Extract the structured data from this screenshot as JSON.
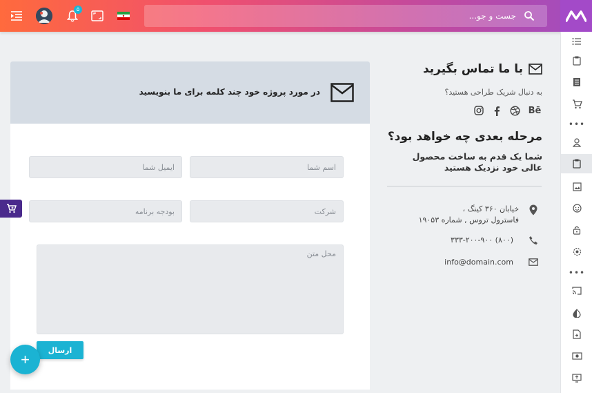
{
  "header": {
    "search_placeholder": "جست و جو...",
    "notification_count": "۵"
  },
  "contact": {
    "title": "با ما تماس بگیرید",
    "subtitle": "به دنبال شریک طراحی هستید؟",
    "social": [
      "behance",
      "dribbble",
      "facebook",
      "instagram"
    ],
    "behance_label": "Bē"
  },
  "next_step": {
    "title": "مرحله بعدی چه خواهد بود؟",
    "description": "شما یک قدم به ساخت محصول عالی خود نزدیک هستید"
  },
  "contact_info": {
    "address_line1": "خیابان ۳۶۰ کینگ ،",
    "address_line2": "فاسترول تروس , شماره ۱۹۰۵۳",
    "phone": "(۸۰۰) ۳۳۳-۲۰۰-۹۰۰",
    "email": "info@domain.com"
  },
  "form": {
    "header_text": "در مورد پروژه خود چند کلمه برای ما بنویسید",
    "name_placeholder": "اسم شما",
    "email_placeholder": "ایمیل شما",
    "company_placeholder": "شرکت",
    "budget_placeholder": "بودجه برنامه",
    "message_placeholder": "محل متن",
    "submit_label": "ارسال"
  },
  "fab_label": "+",
  "colors": {
    "accent": "#1bb3d3",
    "brand": "#a34ac8",
    "topbar_start": "#ff6a3d",
    "topbar_end": "#a04cc0"
  }
}
